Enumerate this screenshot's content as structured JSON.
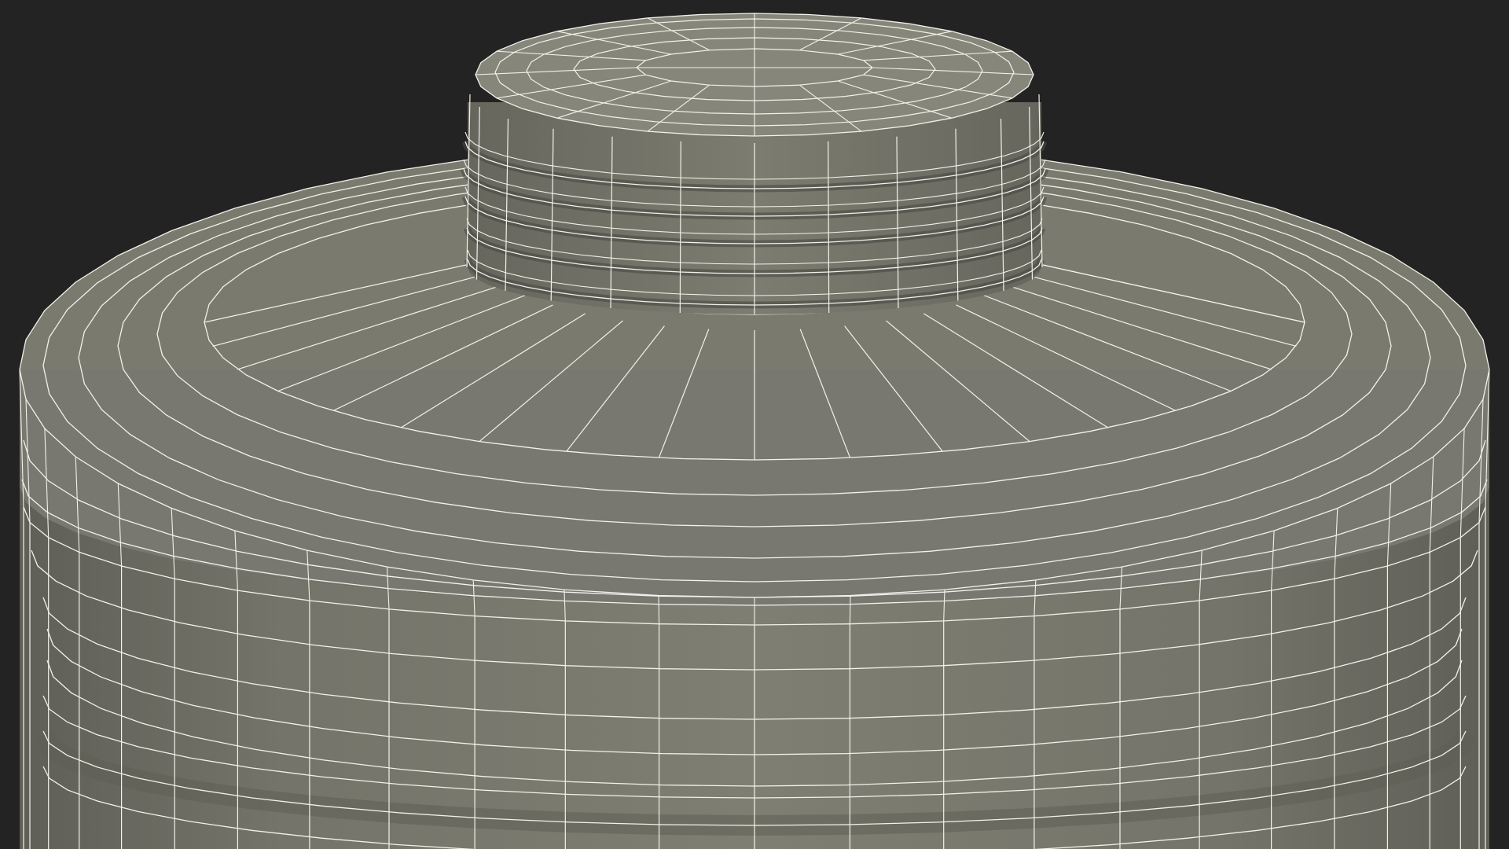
{
  "scene": {
    "subject": "wireframe-bottle-neck",
    "colors": {
      "background": "#232323",
      "surface": "#7a7a6e",
      "surface_dark": "#5e5e55",
      "surface_light": "#86867a",
      "cavity": "#3c3c37",
      "wire": "#f2f2ea"
    }
  }
}
